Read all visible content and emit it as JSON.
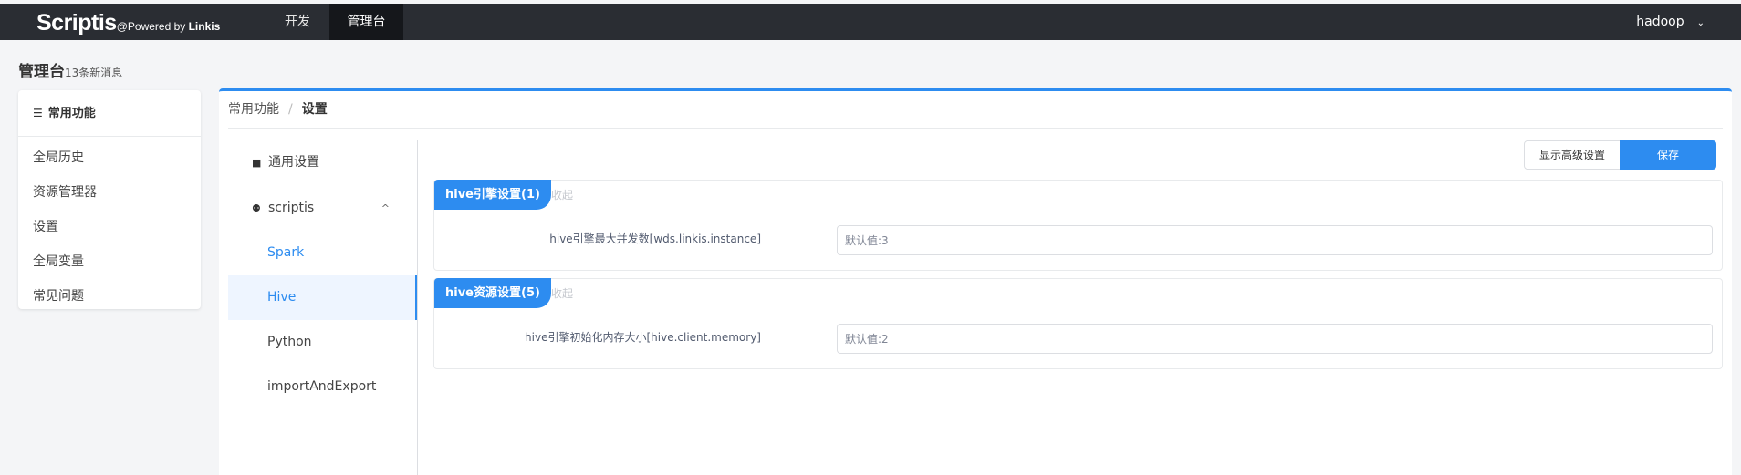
{
  "topbar": {
    "brand": "Scriptis",
    "powered_prefix": "@Powered by ",
    "powered_brand": "Linkis",
    "nav": [
      {
        "label": "开发"
      },
      {
        "label": "管理台",
        "active": true
      }
    ],
    "user": "hadoop",
    "user_chevron": "⌄"
  },
  "page": {
    "title": "管理台",
    "subtitle": "13条新消息"
  },
  "sidebar": {
    "heading": "常用功能",
    "heading_icon": "☰",
    "items": [
      {
        "label": "全局历史"
      },
      {
        "label": "资源管理器"
      },
      {
        "label": "设置"
      },
      {
        "label": "全局变量"
      },
      {
        "label": "常见问题"
      }
    ]
  },
  "breadcrumb": {
    "parent": "常用功能",
    "separator": "/",
    "current": "设置"
  },
  "menu": {
    "general": {
      "label": "通用设置",
      "icon": "■"
    },
    "group": {
      "label": "scriptis",
      "icon": "⚉",
      "arrow": "^"
    },
    "children": [
      {
        "label": "Spark"
      },
      {
        "label": "Hive",
        "active": true
      },
      {
        "label": "Python"
      },
      {
        "label": "importAndExport"
      }
    ]
  },
  "actions": {
    "advanced_label": "显示高级设置",
    "save_label": "保存"
  },
  "panels": [
    {
      "title": "hive引擎设置(1)",
      "collapse": "收起",
      "field_label": "hive引擎最大并发数[wds.linkis.instance]",
      "field_value": "",
      "field_placeholder": "默认值:3"
    },
    {
      "title": "hive资源设置(5)",
      "collapse": "收起",
      "field_label": "hive引擎初始化内存大小[hive.client.memory]",
      "field_value": "",
      "field_placeholder": "默认值:2"
    }
  ],
  "colors": {
    "accent": "#2d8cf0",
    "topbar": "#2a2d33",
    "topbar_active": "#15171b"
  }
}
